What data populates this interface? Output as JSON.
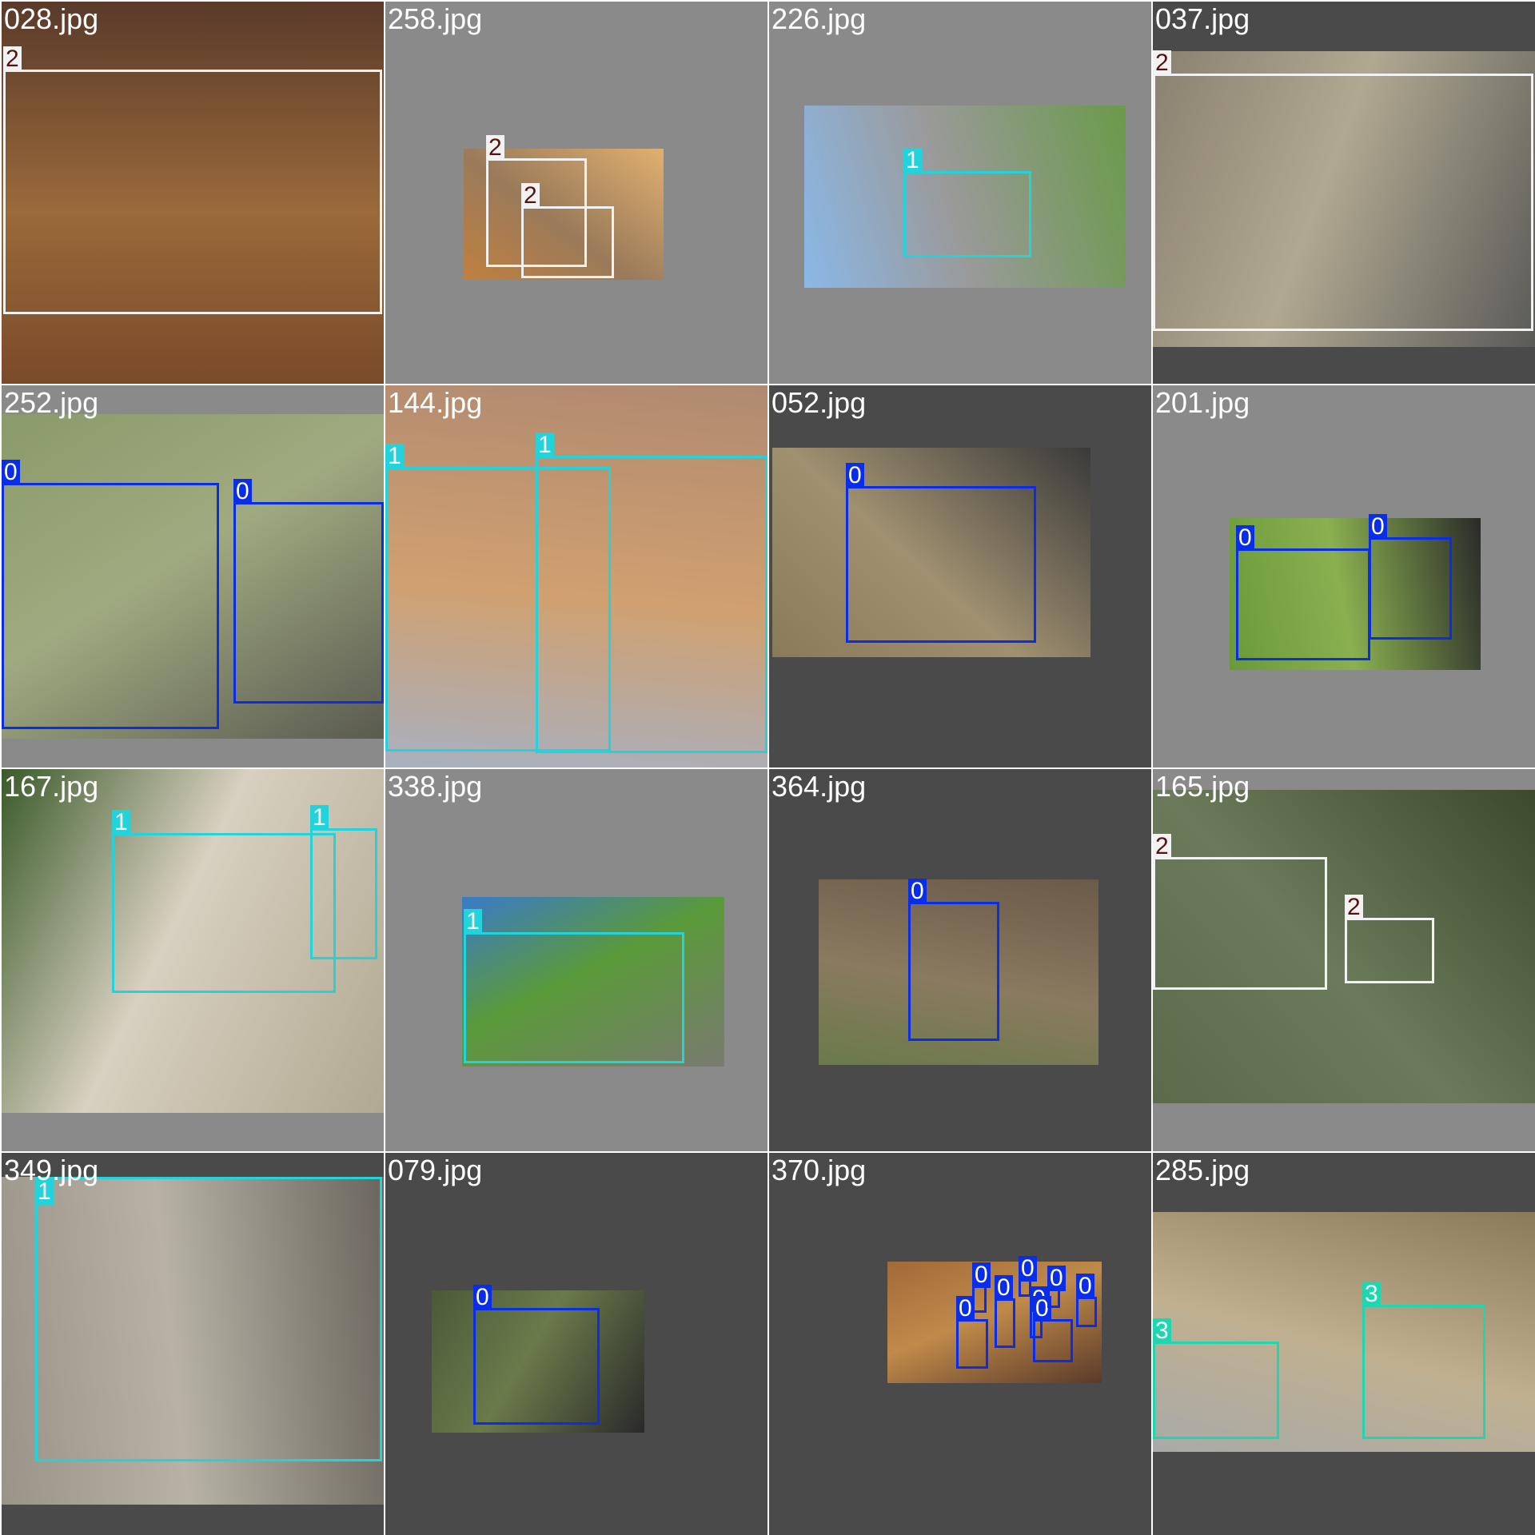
{
  "class_colors": {
    "0": {
      "box": "#0a2ee8",
      "label_bg": "#0a2ee8",
      "label_fg": "#ffffff"
    },
    "1": {
      "box": "#22d3dc",
      "label_bg": "#22d3dc",
      "label_fg": "#ffffff"
    },
    "2": {
      "box": "#f2f2f2",
      "label_bg": "#f2f2f2",
      "label_fg": "#5a1010"
    },
    "3": {
      "box": "#1fd6b0",
      "label_bg": "#1fd6b0",
      "label_fg": "#ffffff"
    }
  },
  "tiles": [
    {
      "filename": "028.jpg",
      "letterbox": "#7a7a7a",
      "photo_colors": [
        "#7a4a2a",
        "#5a3a2a",
        "#9a6a3a"
      ],
      "boxes": [
        {
          "label": "2"
        }
      ]
    },
    {
      "filename": "258.jpg",
      "letterbox": "#8a8a8a",
      "photo_colors": [
        "#c08040",
        "#e0b070",
        "#9a7a5a"
      ],
      "boxes": [
        {
          "label": "2"
        },
        {
          "label": "2"
        }
      ]
    },
    {
      "filename": "226.jpg",
      "letterbox": "#8a8a8a",
      "photo_colors": [
        "#8ab8e8",
        "#6a9a4a",
        "#9a9a9a"
      ],
      "boxes": [
        {
          "label": "1"
        }
      ]
    },
    {
      "filename": "037.jpg",
      "letterbox": "#4a4a4a",
      "photo_colors": [
        "#8a8070",
        "#5a5a58",
        "#b0a890"
      ],
      "boxes": [
        {
          "label": "2"
        }
      ]
    },
    {
      "filename": "252.jpg",
      "letterbox": "#8a8a8a",
      "photo_colors": [
        "#8a9a6a",
        "#5a5a50",
        "#a0aa80"
      ],
      "boxes": [
        {
          "label": "0"
        },
        {
          "label": "0"
        }
      ]
    },
    {
      "filename": "144.jpg",
      "letterbox": "#8a8a8a",
      "photo_colors": [
        "#a8b0c0",
        "#b08a70",
        "#d0a070"
      ],
      "boxes": [
        {
          "label": "1"
        },
        {
          "label": "1"
        }
      ]
    },
    {
      "filename": "052.jpg",
      "letterbox": "#4a4a4a",
      "photo_colors": [
        "#8a7a5a",
        "#3a3a3a",
        "#a09070"
      ],
      "boxes": [
        {
          "label": "0"
        }
      ]
    },
    {
      "filename": "201.jpg",
      "letterbox": "#8a8a8a",
      "photo_colors": [
        "#6a9a3a",
        "#2a2a2a",
        "#8ab050"
      ],
      "boxes": [
        {
          "label": "0"
        },
        {
          "label": "0"
        }
      ]
    },
    {
      "filename": "167.jpg",
      "letterbox": "#8a8a8a",
      "photo_colors": [
        "#3a5a2a",
        "#b0a890",
        "#d8d0c0"
      ],
      "boxes": [
        {
          "label": "1"
        },
        {
          "label": "1"
        }
      ]
    },
    {
      "filename": "338.jpg",
      "letterbox": "#8a8a8a",
      "photo_colors": [
        "#3a7ac8",
        "#7a7a70",
        "#5a9a3a"
      ],
      "boxes": [
        {
          "label": "1"
        }
      ]
    },
    {
      "filename": "364.jpg",
      "letterbox": "#4a4a4a",
      "photo_colors": [
        "#6a7a4a",
        "#6a5a48",
        "#8a7a60"
      ],
      "boxes": [
        {
          "label": "0"
        }
      ]
    },
    {
      "filename": "165.jpg",
      "letterbox": "#8a8a8a",
      "photo_colors": [
        "#5a6a4a",
        "#3a4a2a",
        "#6a7a5a"
      ],
      "boxes": [
        {
          "label": "2"
        },
        {
          "label": "2"
        }
      ]
    },
    {
      "filename": "349.jpg",
      "letterbox": "#4a4a4a",
      "photo_colors": [
        "#9a9488",
        "#6a665e",
        "#b8b2a6"
      ],
      "boxes": [
        {
          "label": "1"
        }
      ]
    },
    {
      "filename": "079.jpg",
      "letterbox": "#4a4a4a",
      "photo_colors": [
        "#4a5a3a",
        "#2a2a2a",
        "#6a7a4a"
      ],
      "boxes": [
        {
          "label": "0"
        }
      ]
    },
    {
      "filename": "370.jpg",
      "letterbox": "#4a4a4a",
      "photo_colors": [
        "#a06a3a",
        "#5a3a2a",
        "#c08a4a"
      ],
      "boxes": [
        {
          "label": "0"
        },
        {
          "label": "0"
        },
        {
          "label": "0"
        },
        {
          "label": "0"
        },
        {
          "label": "0"
        },
        {
          "label": "0"
        },
        {
          "label": "0"
        },
        {
          "label": "0"
        }
      ]
    },
    {
      "filename": "285.jpg",
      "letterbox": "#4a4a4a",
      "photo_colors": [
        "#a8aaa8",
        "#8a7a5a",
        "#c0b090"
      ],
      "boxes": [
        {
          "label": "3"
        },
        {
          "label": "3"
        }
      ]
    }
  ]
}
